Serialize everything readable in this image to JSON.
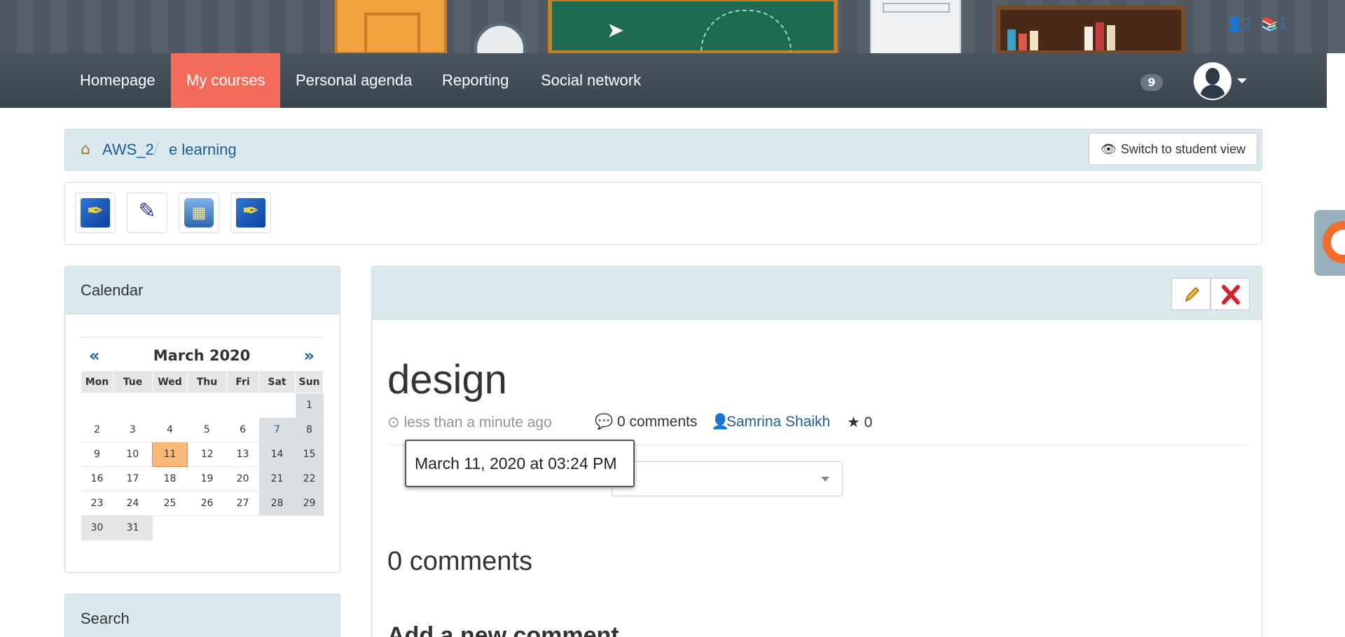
{
  "header": {
    "user_count": "2",
    "course_count": "1"
  },
  "nav": {
    "items": [
      {
        "label": "Homepage"
      },
      {
        "label": "My courses"
      },
      {
        "label": "Personal agenda"
      },
      {
        "label": "Reporting"
      },
      {
        "label": "Social network"
      }
    ],
    "active_index": 1,
    "notification_count": "9"
  },
  "breadcrumb": {
    "items": [
      "AWS_2",
      "e learning"
    ],
    "separator": "/",
    "student_view_label": "Switch to student view"
  },
  "toolbar": {
    "tools": [
      "new-post-icon",
      "quill-icon",
      "typewriter-icon",
      "edit-user-icon"
    ]
  },
  "calendar": {
    "title": "Calendar",
    "month_label": "March 2020",
    "prev_label": "«",
    "next_label": "»",
    "weekdays": [
      "Mon",
      "Tue",
      "Wed",
      "Thu",
      "Fri",
      "Sat",
      "Sun"
    ],
    "weeks": [
      [
        "",
        "",
        "",
        "",
        "",
        "",
        "1"
      ],
      [
        "2",
        "3",
        "4",
        "5",
        "6",
        "7",
        "8"
      ],
      [
        "9",
        "10",
        "11",
        "12",
        "13",
        "14",
        "15"
      ],
      [
        "16",
        "17",
        "18",
        "19",
        "20",
        "21",
        "22"
      ],
      [
        "23",
        "24",
        "25",
        "26",
        "27",
        "28",
        "29"
      ],
      [
        "30",
        "31",
        "",
        "",
        "",
        "",
        ""
      ]
    ],
    "today": "11"
  },
  "post": {
    "title": "design",
    "time": "less than a minute ago",
    "comments_count": "0 comments",
    "author": "Samrina Shaikh",
    "rating": "0",
    "tooltip": "March 11, 2020 at 03:24 PM",
    "comments_heading": "0 comments",
    "add_comment_heading": "Add a new comment"
  },
  "search": {
    "title": "Search"
  },
  "colors": {
    "active_nav": "#f26b5b",
    "panel_bg": "#d9e9ee",
    "link": "#1c5d91",
    "today": "#f9b87a"
  }
}
